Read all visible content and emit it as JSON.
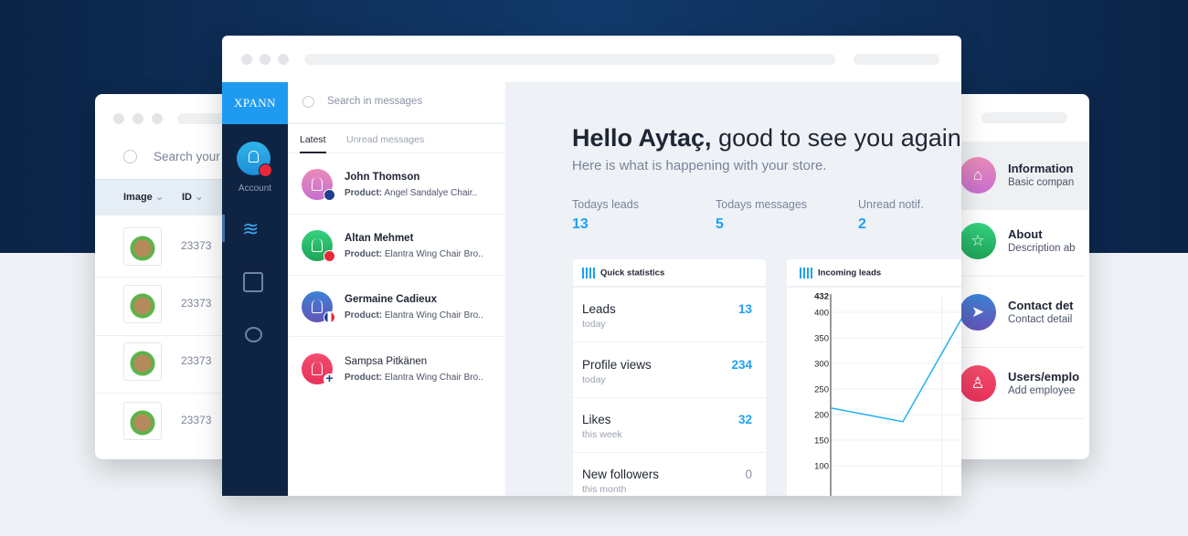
{
  "background_colors": {
    "top": "#0b2447",
    "bottom": "#eef2f6",
    "accent": "#1ea1f2",
    "sidebar": "#0f2342"
  },
  "left_window": {
    "search_placeholder": "Search your",
    "columns": [
      "Image",
      "ID"
    ],
    "rows": [
      {
        "id": "23373"
      },
      {
        "id": "23373"
      },
      {
        "id": "23373"
      },
      {
        "id": "23373"
      }
    ]
  },
  "main_window": {
    "logo": "XPANN",
    "sidebar": {
      "account_label": "Account",
      "icons": [
        "layers-icon",
        "box-icon",
        "chat-icon"
      ]
    },
    "messages": {
      "search_placeholder": "Search in messages",
      "tabs": [
        "Latest",
        "Unread messages"
      ],
      "items": [
        {
          "name": "John Thomson",
          "product_label": "Product:",
          "product": "Angel Sandalye Chair..",
          "avatar_color": "#e06fb8",
          "flag": "uk",
          "unread": true
        },
        {
          "name": "Altan Mehmet",
          "product_label": "Product:",
          "product": "Elantra Wing Chair Bro..",
          "avatar_color": "#27b864",
          "flag": "tr",
          "unread": true
        },
        {
          "name": "Germaine Cadieux",
          "product_label": "Product:",
          "product": "Elantra Wing Chair Bro..",
          "avatar_color": "#4f6bc7",
          "flag": "fr",
          "unread": true
        },
        {
          "name": "Sampsa Pitkänen",
          "product_label": "Product:",
          "product": "Elantra Wing Chair Bro..",
          "avatar_color": "#f03e66",
          "flag": "fi",
          "unread": false
        }
      ]
    },
    "dashboard": {
      "greeting_bold": "Hello Aytaç,",
      "greeting_rest": " good to see you again",
      "subtitle": "Here is what is happening with your store.",
      "stats": [
        {
          "label": "Todays leads",
          "value": "13"
        },
        {
          "label": "Todays messages",
          "value": "5"
        },
        {
          "label": "Unread notif.",
          "value": "2"
        }
      ],
      "quick_stats": {
        "title": "Quick statistics",
        "rows": [
          {
            "title": "Leads",
            "sub": "today",
            "value": "13",
            "highlight": true
          },
          {
            "title": "Profile views",
            "sub": "today",
            "value": "234",
            "highlight": true
          },
          {
            "title": "Likes",
            "sub": "this week",
            "value": "32",
            "highlight": true
          },
          {
            "title": "New followers",
            "sub": "this month",
            "value": "0",
            "highlight": false
          }
        ]
      },
      "incoming_leads": {
        "title": "Incoming leads"
      }
    }
  },
  "right_window": {
    "items": [
      {
        "title": "Information",
        "sub": "Basic compan",
        "color": "#d96fc0",
        "icon": "home-icon"
      },
      {
        "title": "About",
        "sub": "Description ab",
        "color": "#27b864",
        "icon": "star-icon"
      },
      {
        "title": "Contact det",
        "sub": "Contact detail",
        "color": "#4f6bc7",
        "icon": "send-icon"
      },
      {
        "title": "Users/emplo",
        "sub": "Add employee",
        "color": "#f03e66",
        "icon": "user-icon"
      }
    ]
  },
  "chart_data": {
    "type": "line",
    "title": "Incoming leads",
    "y_ticks": [
      "432",
      "400",
      "350",
      "300",
      "250",
      "200",
      "150",
      "100"
    ],
    "ylim": [
      100,
      432
    ],
    "grid": true,
    "series": [
      {
        "values": [
          213,
          186,
          390
        ]
      }
    ]
  }
}
